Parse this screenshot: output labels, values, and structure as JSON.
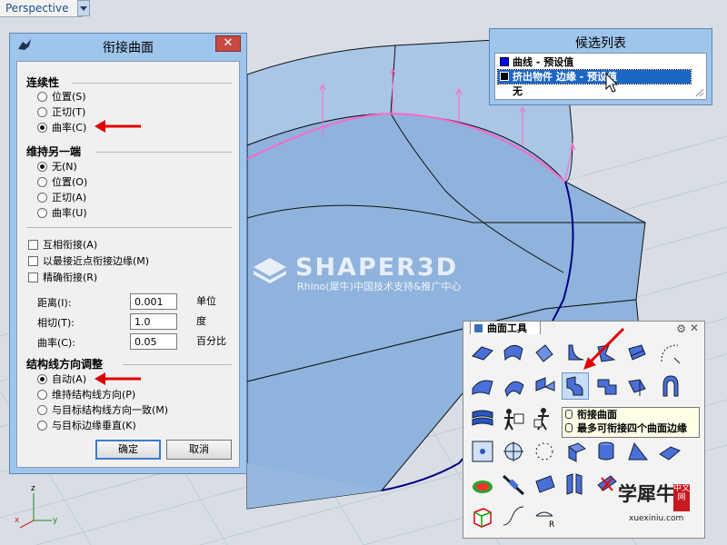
{
  "viewport": {
    "title": "Perspective"
  },
  "blend_dialog": {
    "title": "衔接曲面",
    "continuity": {
      "label": "连续性",
      "options": [
        "位置(S)",
        "正切(T)",
        "曲率(C)"
      ],
      "selected": "曲率(C)"
    },
    "other_end": {
      "label": "维持另一端",
      "options": [
        "无(N)",
        "位置(O)",
        "正切(A)",
        "曲率(U)"
      ],
      "selected": "无(N)"
    },
    "checkboxes": [
      "互相衔接(A)",
      "以最接近点衔接边缘(M)",
      "精确衔接(R)"
    ],
    "fields": [
      {
        "label": "距离(I):",
        "value": "0.001",
        "unit": "单位"
      },
      {
        "label": "相切(T):",
        "value": "1.0",
        "unit": "度"
      },
      {
        "label": "曲率(C):",
        "value": "0.05",
        "unit": "百分比"
      }
    ],
    "isocurve": {
      "label": "结构线方向调整",
      "options": [
        "自动(A)",
        "维持结构线方向(P)",
        "与目标结构线方向一致(M)",
        "与目标边缘垂直(K)"
      ],
      "selected": "自动(A)"
    },
    "ok_label": "确定",
    "cancel_label": "取消",
    "close_label": "✕"
  },
  "candidate_list": {
    "title": "候选列表",
    "items": [
      {
        "label": "曲线 - 预设值",
        "swatch": "#0000ff",
        "selected": false
      },
      {
        "label": "挤出物件 边缘 - 预设值",
        "swatch": "#000000",
        "selected": true
      },
      {
        "label": "无",
        "swatch": "",
        "selected": false
      }
    ]
  },
  "palette": {
    "title": "曲面工具",
    "tooltip": [
      "衔接曲面",
      "最多可衔接四个曲面边缘"
    ]
  },
  "watermark": {
    "main": "SHAPER3D",
    "sub": "Rhino(犀牛)中国技术支持&推广中心",
    "brand": "学犀牛",
    "badge": "中文网",
    "url": "xuexiniu.com"
  },
  "axes": {
    "z": "z",
    "x": "x",
    "y": "y"
  },
  "colors": {
    "dialog_frame": "#9ec5ec",
    "surface": "#8fb3dc",
    "edge": "#000080",
    "blend_curve": "#ff66cc",
    "arrow": "#e00000"
  }
}
